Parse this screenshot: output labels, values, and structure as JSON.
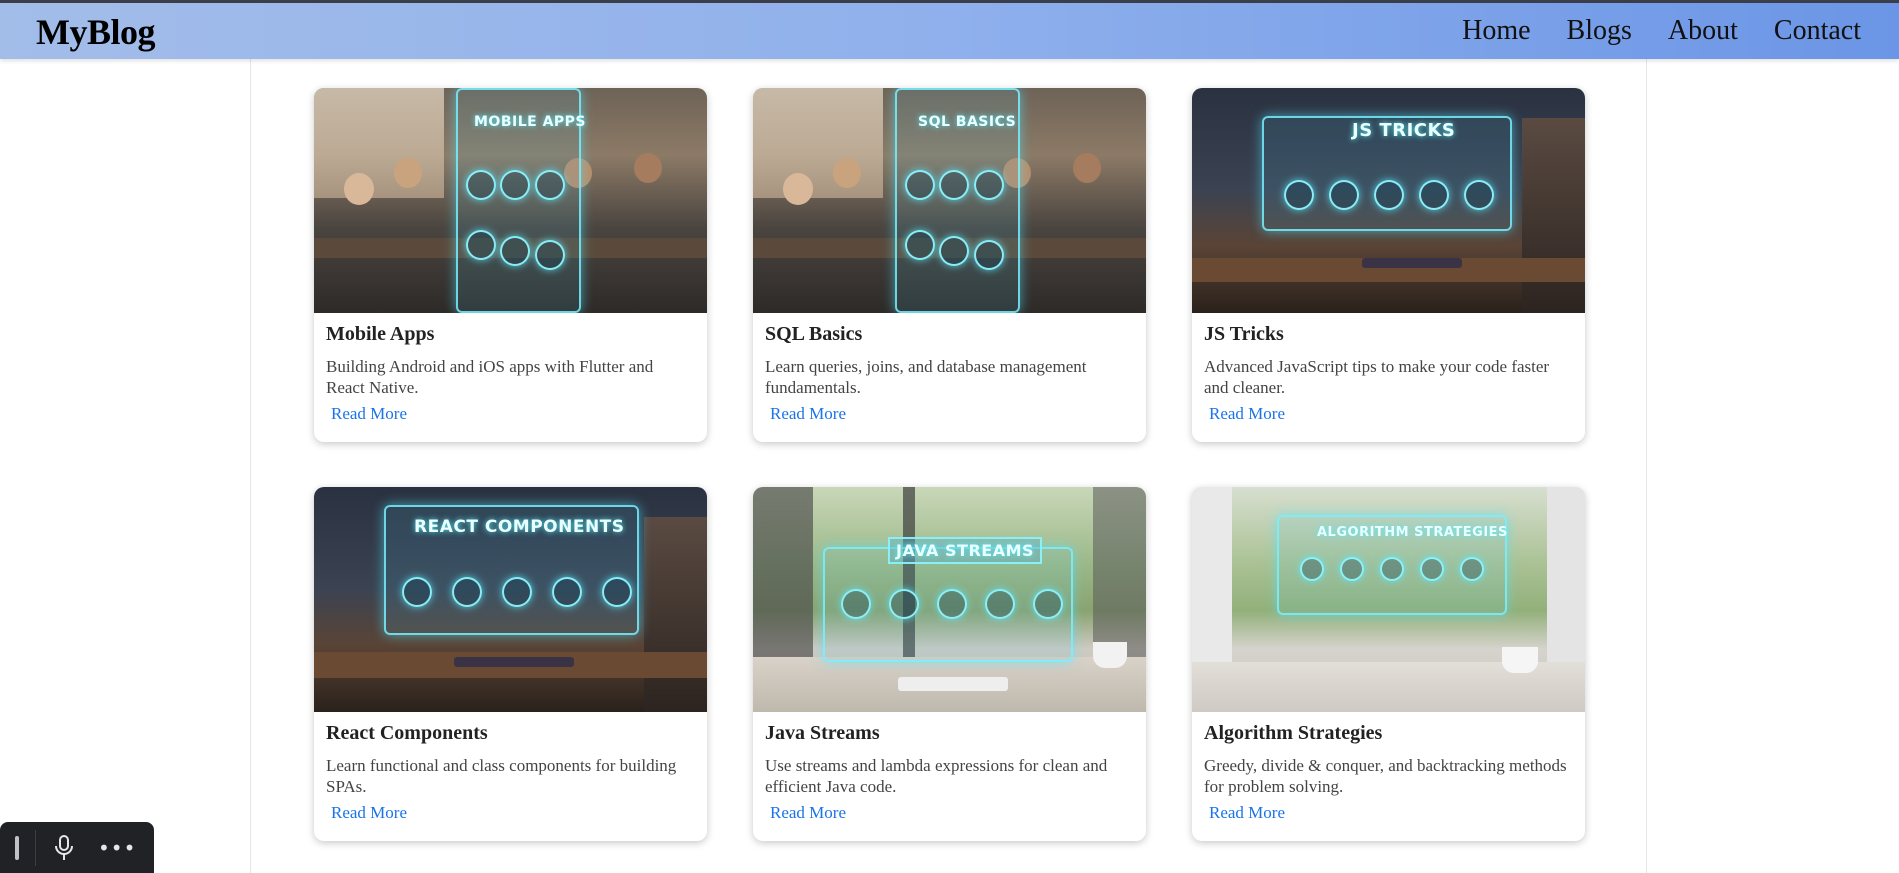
{
  "header": {
    "brand": "MyBlog",
    "nav": [
      "Home",
      "Blogs",
      "About",
      "Contact"
    ]
  },
  "cards": [
    {
      "title": "Mobile Apps",
      "description": "Building Android and iOS apps with Flutter and React Native.",
      "link": "Read More",
      "image_label": "MOBILE APPS"
    },
    {
      "title": "SQL Basics",
      "description": "Learn queries, joins, and database management fundamentals.",
      "link": "Read More",
      "image_label": "SQL BASICS"
    },
    {
      "title": "JS Tricks",
      "description": "Advanced JavaScript tips to make your code faster and cleaner.",
      "link": "Read More",
      "image_label": "JS TRICKS"
    },
    {
      "title": "React Components",
      "description": "Learn functional and class components for building SPAs.",
      "link": "Read More",
      "image_label": "REACT COMPONENTS"
    },
    {
      "title": "Java Streams",
      "description": "Use streams and lambda expressions for clean and efficient Java code.",
      "link": "Read More",
      "image_label": "JAVA STREAMS"
    },
    {
      "title": "Algorithm Strategies",
      "description": "Greedy, divide & conquer, and backtracking methods for problem solving.",
      "link": "Read More",
      "image_label": "ALGORITHM STRATEGIES"
    }
  ],
  "colors": {
    "link": "#1a73e8",
    "navbar_start": "#a3bde9",
    "navbar_end": "#6b95e6"
  },
  "dock": {
    "icons": [
      "drag-handle-icon",
      "microphone-icon",
      "more-options-icon"
    ],
    "more_glyph": "•••"
  }
}
